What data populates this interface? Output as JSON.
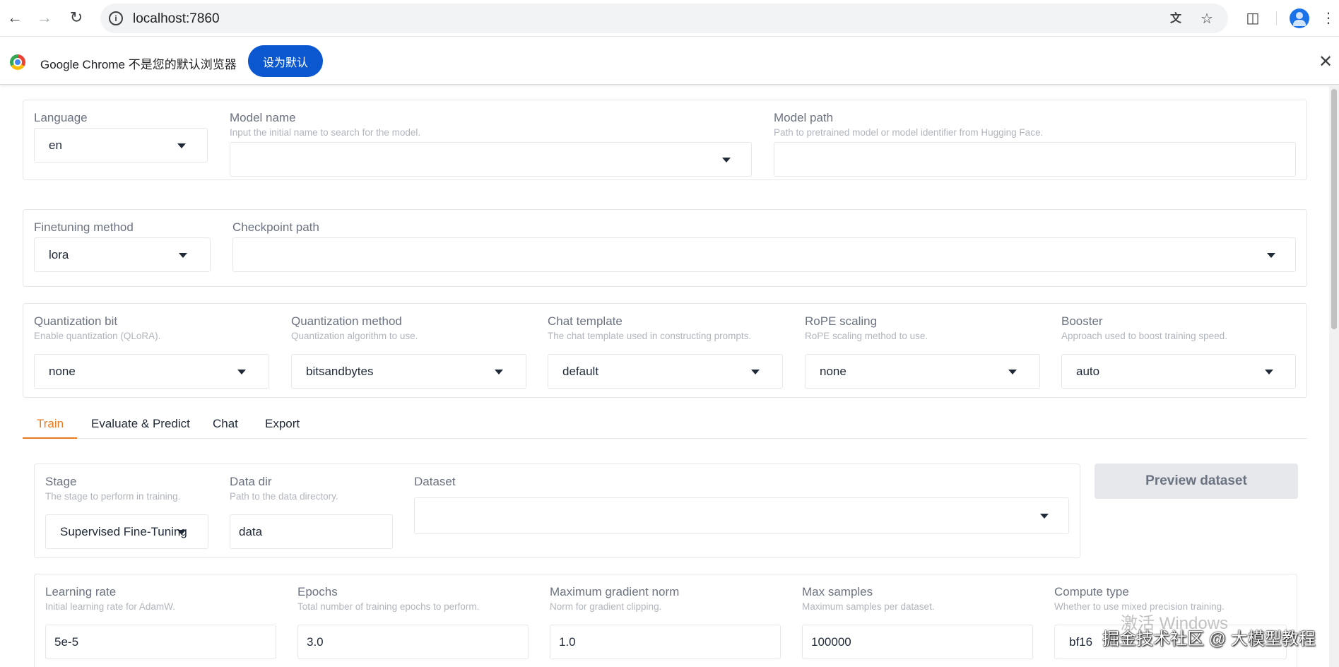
{
  "browser": {
    "url": "localhost:7860",
    "infobar_text": "Google Chrome 不是您的默认浏览器",
    "infobar_button": "设为默认",
    "icons": [
      "back-icon",
      "forward-icon",
      "reload-icon",
      "info-icon",
      "translate-icon",
      "star-icon",
      "extensions-icon",
      "profile-icon",
      "more-icon",
      "close-icon"
    ]
  },
  "top": {
    "language": {
      "label": "Language",
      "value": "en"
    },
    "model_name": {
      "label": "Model name",
      "info": "Input the initial name to search for the model.",
      "value": ""
    },
    "model_path": {
      "label": "Model path",
      "info": "Path to pretrained model or model identifier from Hugging Face.",
      "value": ""
    }
  },
  "finetune": {
    "method": {
      "label": "Finetuning method",
      "value": "lora"
    },
    "checkpoint": {
      "label": "Checkpoint path",
      "value": ""
    }
  },
  "advanced": {
    "quant_bit": {
      "label": "Quantization bit",
      "info": "Enable quantization (QLoRA).",
      "value": "none"
    },
    "quant_method": {
      "label": "Quantization method",
      "info": "Quantization algorithm to use.",
      "value": "bitsandbytes"
    },
    "template": {
      "label": "Chat template",
      "info": "The chat template used in constructing prompts.",
      "value": "default"
    },
    "rope": {
      "label": "RoPE scaling",
      "info": "RoPE scaling method to use.",
      "value": "none"
    },
    "booster": {
      "label": "Booster",
      "info": "Approach used to boost training speed.",
      "value": "auto"
    }
  },
  "tabs": [
    "Train",
    "Evaluate & Predict",
    "Chat",
    "Export"
  ],
  "train": {
    "stage": {
      "label": "Stage",
      "info": "The stage to perform in training.",
      "value": "Supervised Fine-Tuning"
    },
    "data_dir": {
      "label": "Data dir",
      "info": "Path to the data directory.",
      "value": "data"
    },
    "dataset": {
      "label": "Dataset",
      "value": ""
    },
    "preview_button": "Preview dataset",
    "learning_rate": {
      "label": "Learning rate",
      "info": "Initial learning rate for AdamW.",
      "value": "5e-5"
    },
    "epochs": {
      "label": "Epochs",
      "info": "Total number of training epochs to perform.",
      "value": "3.0"
    },
    "max_grad_norm": {
      "label": "Maximum gradient norm",
      "info": "Norm for gradient clipping.",
      "value": "1.0"
    },
    "max_samples": {
      "label": "Max samples",
      "info": "Maximum samples per dataset.",
      "value": "100000"
    },
    "compute_type": {
      "label": "Compute type",
      "info": "Whether to use mixed precision training.",
      "value": "bf16"
    }
  },
  "watermarks": {
    "windows": "激活 Windows",
    "site": "掘金技术社区 @ 大模型教程"
  }
}
